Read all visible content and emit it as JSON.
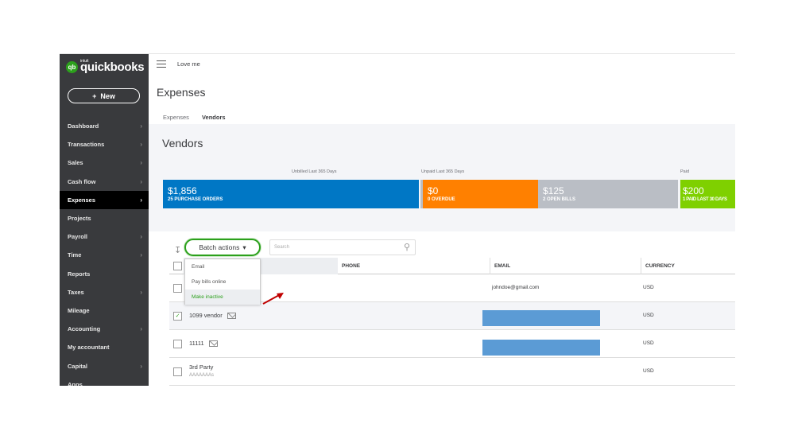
{
  "app": {
    "brand_small": "intuit",
    "brand": "quickbooks",
    "company": "Love me",
    "new_label": "New"
  },
  "sidebar": {
    "items": [
      {
        "label": "Dashboard",
        "chevron": true
      },
      {
        "label": "Transactions",
        "chevron": true
      },
      {
        "label": "Sales",
        "chevron": true
      },
      {
        "label": "Cash flow",
        "chevron": true
      },
      {
        "label": "Expenses",
        "chevron": true,
        "active": true
      },
      {
        "label": "Projects",
        "chevron": false
      },
      {
        "label": "Payroll",
        "chevron": true
      },
      {
        "label": "Time",
        "chevron": true
      },
      {
        "label": "Reports",
        "chevron": false
      },
      {
        "label": "Taxes",
        "chevron": true
      },
      {
        "label": "Mileage",
        "chevron": false
      },
      {
        "label": "Accounting",
        "chevron": true
      },
      {
        "label": "My accountant",
        "chevron": false
      },
      {
        "label": "Capital",
        "chevron": true
      },
      {
        "label": "Apps",
        "chevron": false
      }
    ]
  },
  "page": {
    "title": "Expenses",
    "tabs": [
      "Expenses",
      "Vendors"
    ],
    "active_tab": "Vendors",
    "section_title": "Vendors"
  },
  "summary": {
    "unbilled_label": "Unbilled Last 365 Days",
    "unpaid_label": "Unpaid Last 365 Days",
    "paid_label": "Paid",
    "cards": [
      {
        "amount": "$1,856",
        "sub": "25 PURCHASE ORDERS",
        "color": "#0077c5"
      },
      {
        "amount": "$0",
        "sub": "0 OVERDUE",
        "color": "#ff8000"
      },
      {
        "amount": "$125",
        "sub": "2 OPEN BILLS",
        "color": "#babec5"
      },
      {
        "amount": "$200",
        "sub": "1 PAID LAST 30 DAYS",
        "color": "#7fd000"
      }
    ]
  },
  "toolbar": {
    "batch_label": "Batch actions",
    "search_placeholder": "Search"
  },
  "batch_menu": [
    "Email",
    "Pay bills online",
    "Make inactive"
  ],
  "table": {
    "headers": [
      "PHONE",
      "EMAIL",
      "CURRENCY"
    ],
    "rows": [
      {
        "name": "",
        "sub": "",
        "email": "johndoe@gmail.com",
        "currency": "USD",
        "checked": false
      },
      {
        "name": "1099 vendor",
        "sub": "",
        "email": "",
        "currency": "USD",
        "checked": true
      },
      {
        "name": "11111",
        "sub": "",
        "email": "",
        "currency": "USD",
        "checked": false
      },
      {
        "name": "3rd Party",
        "sub": "AAAAAAAs",
        "email": "",
        "currency": "USD",
        "checked": false
      }
    ]
  }
}
